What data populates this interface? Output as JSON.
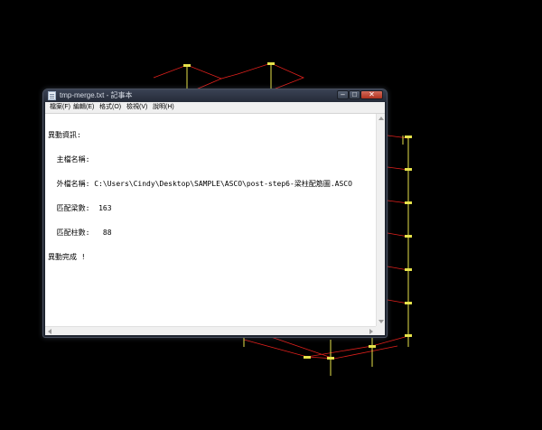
{
  "window": {
    "title": "tmp-merge.txt - 記事本",
    "controls": {
      "minimize": "–",
      "maximize": "□",
      "close": "✕"
    }
  },
  "menu": {
    "items": [
      {
        "label": "檔案(F)"
      },
      {
        "label": "編輯(E)"
      },
      {
        "label": "格式(O)"
      },
      {
        "label": "檢視(V)"
      },
      {
        "label": "說明(H)"
      }
    ]
  },
  "document": {
    "lines": [
      "異動資訊:",
      "  主檔名稱:",
      "  外檔名稱: C:\\Users\\Cindy\\Desktop\\SAMPLE\\ASCO\\post-step6-梁柱配筋圖.ASCO",
      "  匹配梁數:  163",
      "  匹配柱數:   88",
      "異動完成 !"
    ]
  },
  "colors": {
    "cad_frame": "#e0201c",
    "cad_column": "#e6e24a",
    "desktop_bg": "#000000"
  },
  "icons": {
    "app": "notepad-icon",
    "scroll": [
      "scroll-up-icon",
      "scroll-down-icon",
      "scroll-left-icon",
      "scroll-right-icon"
    ]
  }
}
